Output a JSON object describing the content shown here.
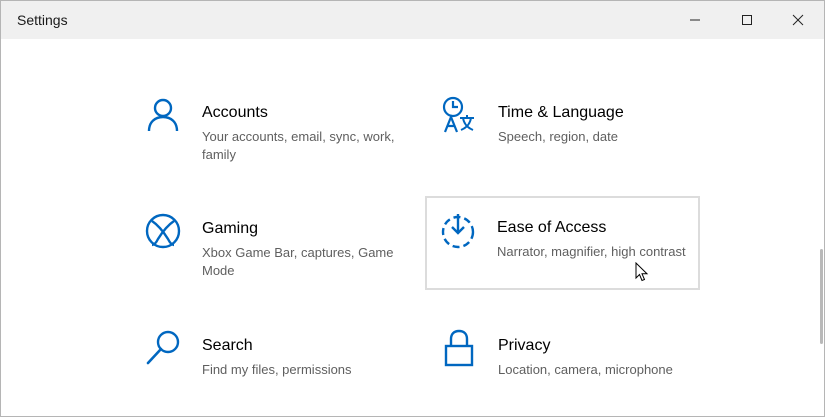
{
  "window": {
    "title": "Settings"
  },
  "tiles": [
    {
      "name": "Accounts",
      "desc": "Your accounts, email, sync, work, family",
      "icon": "person-icon"
    },
    {
      "name": "Time & Language",
      "desc": "Speech, region, date",
      "icon": "time-language-icon"
    },
    {
      "name": "Gaming",
      "desc": "Xbox Game Bar, captures, Game Mode",
      "icon": "xbox-icon"
    },
    {
      "name": "Ease of Access",
      "desc": "Narrator, magnifier, high contrast",
      "icon": "ease-of-access-icon"
    },
    {
      "name": "Search",
      "desc": "Find my files, permissions",
      "icon": "search-icon"
    },
    {
      "name": "Privacy",
      "desc": "Location, camera, microphone",
      "icon": "lock-icon"
    }
  ],
  "colors": {
    "accent": "#0067c0",
    "titlebar": "#f0f0f0",
    "hover_border": "#dcdcdc"
  }
}
